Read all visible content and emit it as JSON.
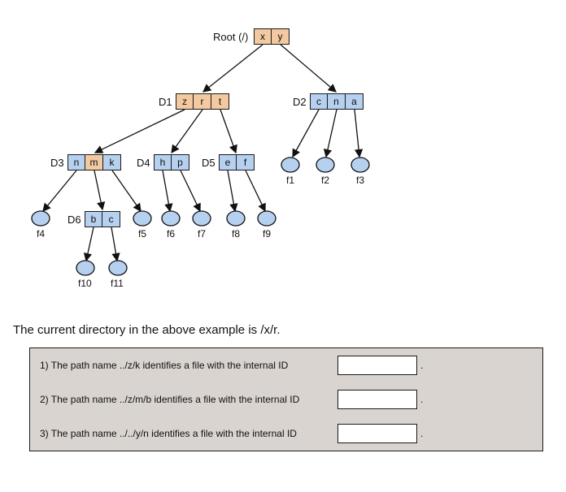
{
  "root": {
    "label": "Root (/)",
    "cells": [
      "x",
      "y"
    ]
  },
  "d1": {
    "label": "D1",
    "cells": [
      "z",
      "r",
      "t"
    ]
  },
  "d2": {
    "label": "D2",
    "cells": [
      "c",
      "n",
      "a"
    ]
  },
  "d3": {
    "label": "D3",
    "cells": [
      "n",
      "m",
      "k"
    ]
  },
  "d4": {
    "label": "D4",
    "cells": [
      "h",
      "p"
    ]
  },
  "d5": {
    "label": "D5",
    "cells": [
      "e",
      "f"
    ]
  },
  "d6": {
    "label": "D6",
    "cells": [
      "b",
      "c"
    ]
  },
  "files": {
    "f1": "f1",
    "f2": "f2",
    "f3": "f3",
    "f4": "f4",
    "f5": "f5",
    "f6": "f6",
    "f7": "f7",
    "f8": "f8",
    "f9": "f9",
    "f10": "f10",
    "f11": "f11"
  },
  "statement": "The current directory in the above example is /x/r.",
  "questions": {
    "q1": "1) The path name ../z/k identifies a file with the internal ID",
    "q2": "2) The path name ../z/m/b identifies a file with the internal ID",
    "q3": "3) The path name ../../y/n identifies a file with the internal ID",
    "a1": "",
    "a2": "",
    "a3": ""
  },
  "period": "."
}
